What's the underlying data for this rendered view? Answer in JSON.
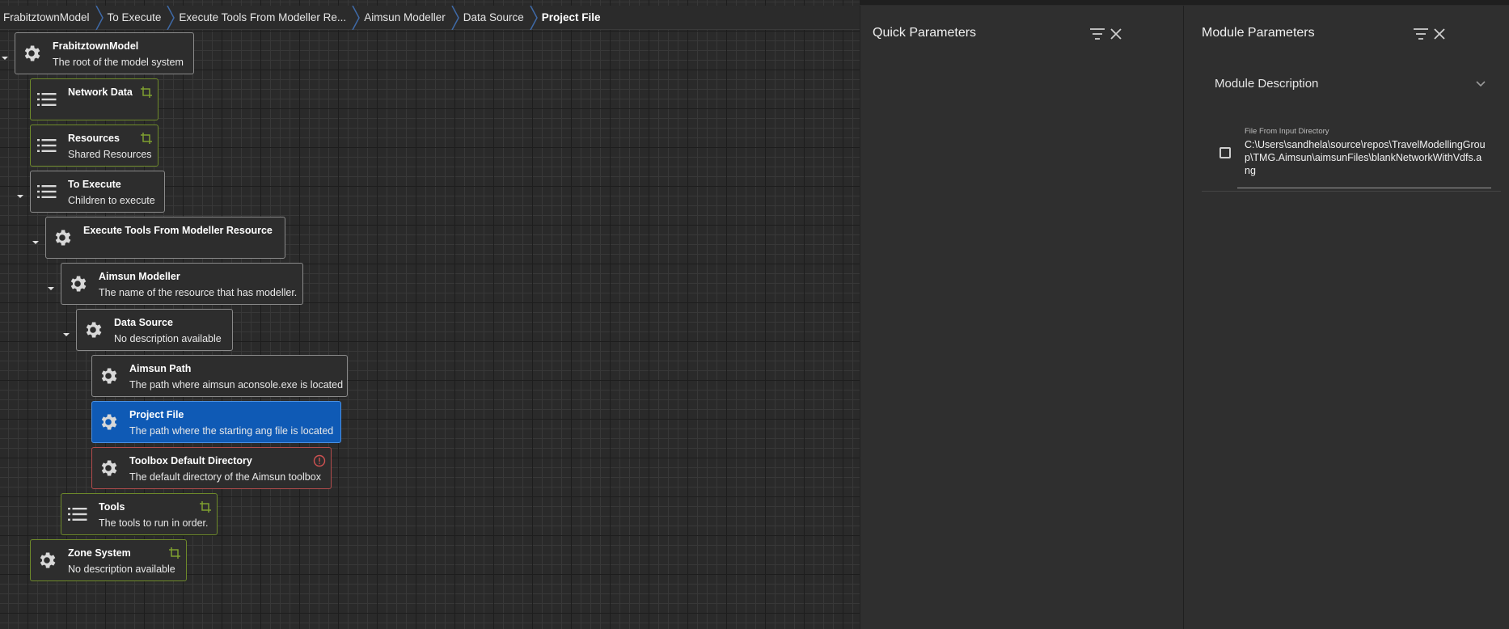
{
  "breadcrumb": [
    {
      "label": "FrabitztownModel"
    },
    {
      "label": "To Execute"
    },
    {
      "label": "Execute Tools From Modeller Re..."
    },
    {
      "label": "Aimsun Modeller"
    },
    {
      "label": "Data Source"
    },
    {
      "label": "Project File"
    }
  ],
  "tree": [
    {
      "name": "FrabitztownModel",
      "desc": "The root of the model system",
      "icon": "gear-icon"
    },
    {
      "name": "Network Data",
      "desc": "",
      "icon": "list-icon",
      "badge": "crop-icon"
    },
    {
      "name": "Resources",
      "desc": "Shared Resources",
      "icon": "list-icon",
      "badge": "crop-icon"
    },
    {
      "name": "To Execute",
      "desc": "Children to execute",
      "icon": "list-icon"
    },
    {
      "name": "Execute Tools From Modeller Resource",
      "desc": "",
      "icon": "gear-icon"
    },
    {
      "name": "Aimsun Modeller",
      "desc": "The name of the resource that has modeller.",
      "icon": "gear-icon"
    },
    {
      "name": "Data Source",
      "desc": "No description available",
      "icon": "gear-icon"
    },
    {
      "name": "Aimsun Path",
      "desc": "The path where aimsun aconsole.exe is located",
      "icon": "gear-icon"
    },
    {
      "name": "Project File",
      "desc": "The path where the starting ang file is located",
      "icon": "gear-icon"
    },
    {
      "name": "Toolbox Default Directory",
      "desc": "The default directory of the Aimsun toolbox",
      "icon": "gear-icon",
      "badge": "error-icon"
    },
    {
      "name": "Tools",
      "desc": "The tools to run in order.",
      "icon": "list-icon",
      "badge": "crop-icon"
    },
    {
      "name": "Zone System",
      "desc": "No description available",
      "icon": "gear-icon",
      "badge": "crop-icon"
    }
  ],
  "quick_panel": {
    "title": "Quick Parameters"
  },
  "module_panel": {
    "title": "Module Parameters",
    "description_label": "Module Description",
    "param_label": "File From Input Directory",
    "param_value": "C:\\Users\\sandhela\\source\\repos\\TravelModellingGroup\\TMG.Aimsun\\aimsunFiles\\blankNetworkWithVdfs.ang",
    "param_checked": false
  },
  "colors": {
    "selected": "#0f5ab5",
    "green_border": "#6e8a2a",
    "error_border": "#b24c4c"
  }
}
